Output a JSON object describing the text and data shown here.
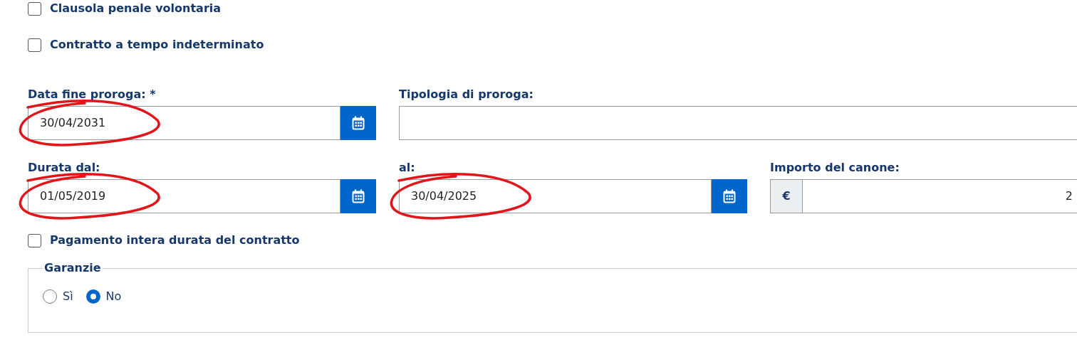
{
  "checkboxes_top": [
    {
      "label": "Clausola penale volontaria",
      "checked": false
    },
    {
      "label": "Contratto a tempo indeterminato",
      "checked": false
    }
  ],
  "rows": [
    [
      {
        "kind": "date",
        "label": "Data fine proroga: *",
        "value": "30/04/2031",
        "circled": true
      },
      {
        "kind": "text",
        "label": "Tipologia di proroga:",
        "wide": true
      }
    ],
    [
      {
        "kind": "date",
        "label": "Durata dal:",
        "value": "01/05/2019",
        "circled": true
      },
      {
        "kind": "date",
        "label": "al:",
        "value": "30/04/2025",
        "circled": true
      },
      {
        "kind": "currency",
        "label": "Importo del canone:",
        "prefix": "€",
        "value": "2"
      }
    ]
  ],
  "checkbox_bottom": {
    "label": "Pagamento intera durata del contratto",
    "checked": false
  },
  "guarantees": {
    "legend": "Garanzie",
    "options": [
      {
        "label": "Sì",
        "selected": false
      },
      {
        "label": "No",
        "selected": true
      }
    ]
  }
}
